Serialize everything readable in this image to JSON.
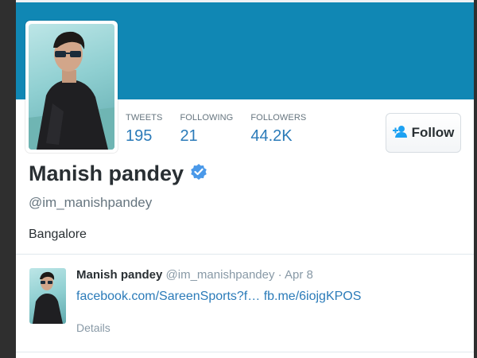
{
  "colors": {
    "banner": "#1087b4",
    "link": "#2b7bb9",
    "text": "#292f33",
    "muted": "#66757f",
    "verified": "#4a99e9"
  },
  "profile": {
    "name": "Manish pandey",
    "handle": "@im_manishpandey",
    "location": "Bangalore",
    "verified": true,
    "avatar_icon": "profile-photo"
  },
  "stats": [
    {
      "label": "TWEETS",
      "value": "195"
    },
    {
      "label": "FOLLOWING",
      "value": "21"
    },
    {
      "label": "FOLLOWERS",
      "value": "44.2K"
    }
  ],
  "follow_button": {
    "label": "Follow",
    "icon": "add-user-icon"
  },
  "tweet": {
    "name": "Manish pandey",
    "handle": "@im_manishpandey",
    "separator": "·",
    "date": "Apr 8",
    "link1": "facebook.com/SareenSports?f…",
    "link2": "fb.me/6iojgKPOS",
    "details_label": "Details"
  }
}
